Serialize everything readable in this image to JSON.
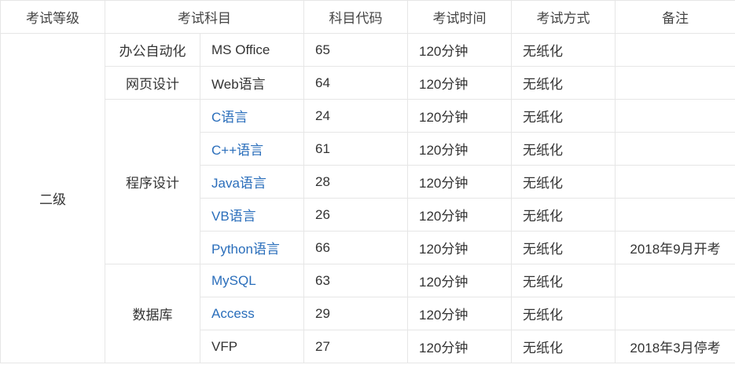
{
  "headers": {
    "level": "考试等级",
    "subject": "考试科目",
    "code": "科目代码",
    "time": "考试时间",
    "method": "考试方式",
    "remark": "备注"
  },
  "level": "二级",
  "groups": {
    "office": "办公自动化",
    "web": "网页设计",
    "programming": "程序设计",
    "database": "数据库"
  },
  "rows": [
    {
      "name": "MS Office",
      "code": "65",
      "time": "120分钟",
      "method": "无纸化",
      "remark": ""
    },
    {
      "name": "Web语言",
      "code": "64",
      "time": "120分钟",
      "method": "无纸化",
      "remark": ""
    },
    {
      "name": "C语言",
      "code": "24",
      "time": "120分钟",
      "method": "无纸化",
      "remark": ""
    },
    {
      "name": "C++语言",
      "code": "61",
      "time": "120分钟",
      "method": "无纸化",
      "remark": ""
    },
    {
      "name": "Java语言",
      "code": "28",
      "time": "120分钟",
      "method": "无纸化",
      "remark": ""
    },
    {
      "name": "VB语言",
      "code": "26",
      "time": "120分钟",
      "method": "无纸化",
      "remark": ""
    },
    {
      "name": "Python语言",
      "code": "66",
      "time": "120分钟",
      "method": "无纸化",
      "remark": "2018年9月开考"
    },
    {
      "name": "MySQL",
      "code": "63",
      "time": "120分钟",
      "method": "无纸化",
      "remark": ""
    },
    {
      "name": "Access",
      "code": "29",
      "time": "120分钟",
      "method": "无纸化",
      "remark": ""
    },
    {
      "name": "VFP",
      "code": "27",
      "time": "120分钟",
      "method": "无纸化",
      "remark": "2018年3月停考"
    }
  ],
  "colors": {
    "link": "#2a6ebb",
    "text": "#333333",
    "border": "#e6e6e6"
  }
}
